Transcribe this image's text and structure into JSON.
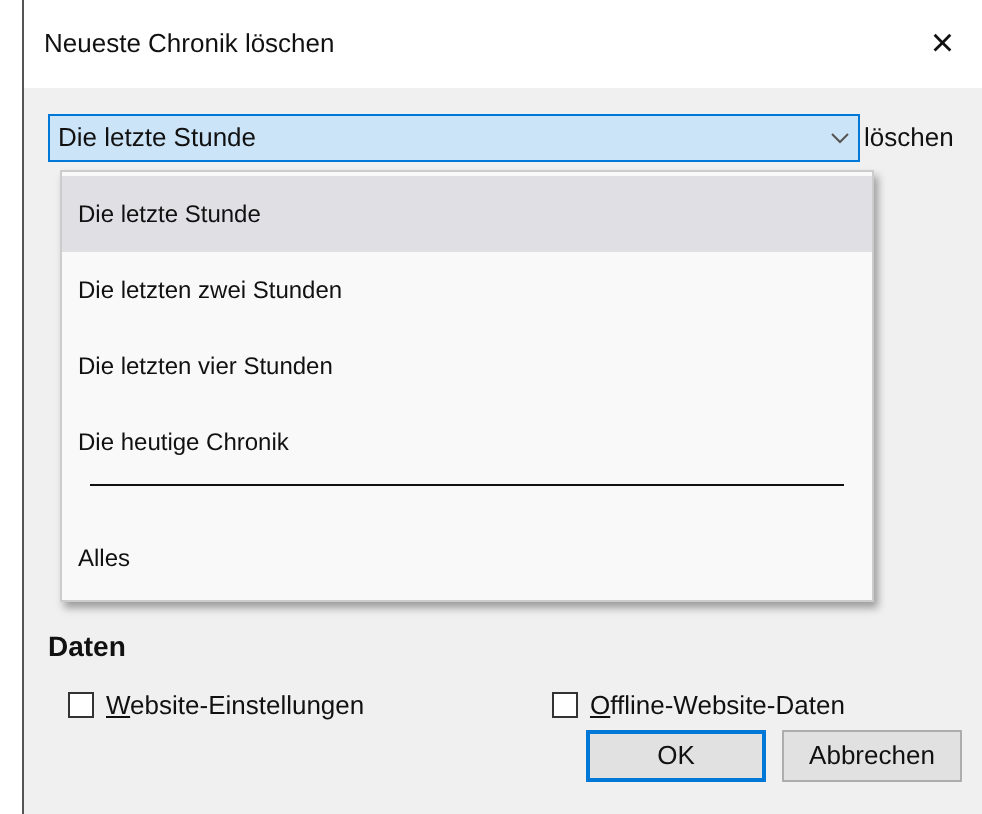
{
  "window": {
    "title": "Neueste Chronik löschen",
    "close": "×"
  },
  "range": {
    "value": "Die letzte Stunde",
    "expanded": true,
    "trailing_label": "löschen",
    "options": [
      {
        "label": "Die letzte Stunde",
        "selected": true,
        "kind": "option"
      },
      {
        "label": "Die letzten zwei Stunden",
        "selected": false,
        "kind": "option"
      },
      {
        "label": "Die letzten vier Stunden",
        "selected": false,
        "kind": "option"
      },
      {
        "label": "Die heutige Chronik",
        "selected": false,
        "kind": "option"
      },
      {
        "kind": "separator"
      },
      {
        "label": "Alles",
        "selected": false,
        "kind": "option"
      }
    ]
  },
  "data_section": {
    "heading": "Daten",
    "checkboxes": [
      {
        "accel": "W",
        "label": "ebsite-Einstellungen",
        "checked": false
      },
      {
        "accel": "O",
        "label": "ffline-Website-Daten",
        "checked": false
      }
    ]
  },
  "buttons": [
    {
      "label": "OK",
      "default": true
    },
    {
      "label": "Abbrechen",
      "default": false
    }
  ]
}
